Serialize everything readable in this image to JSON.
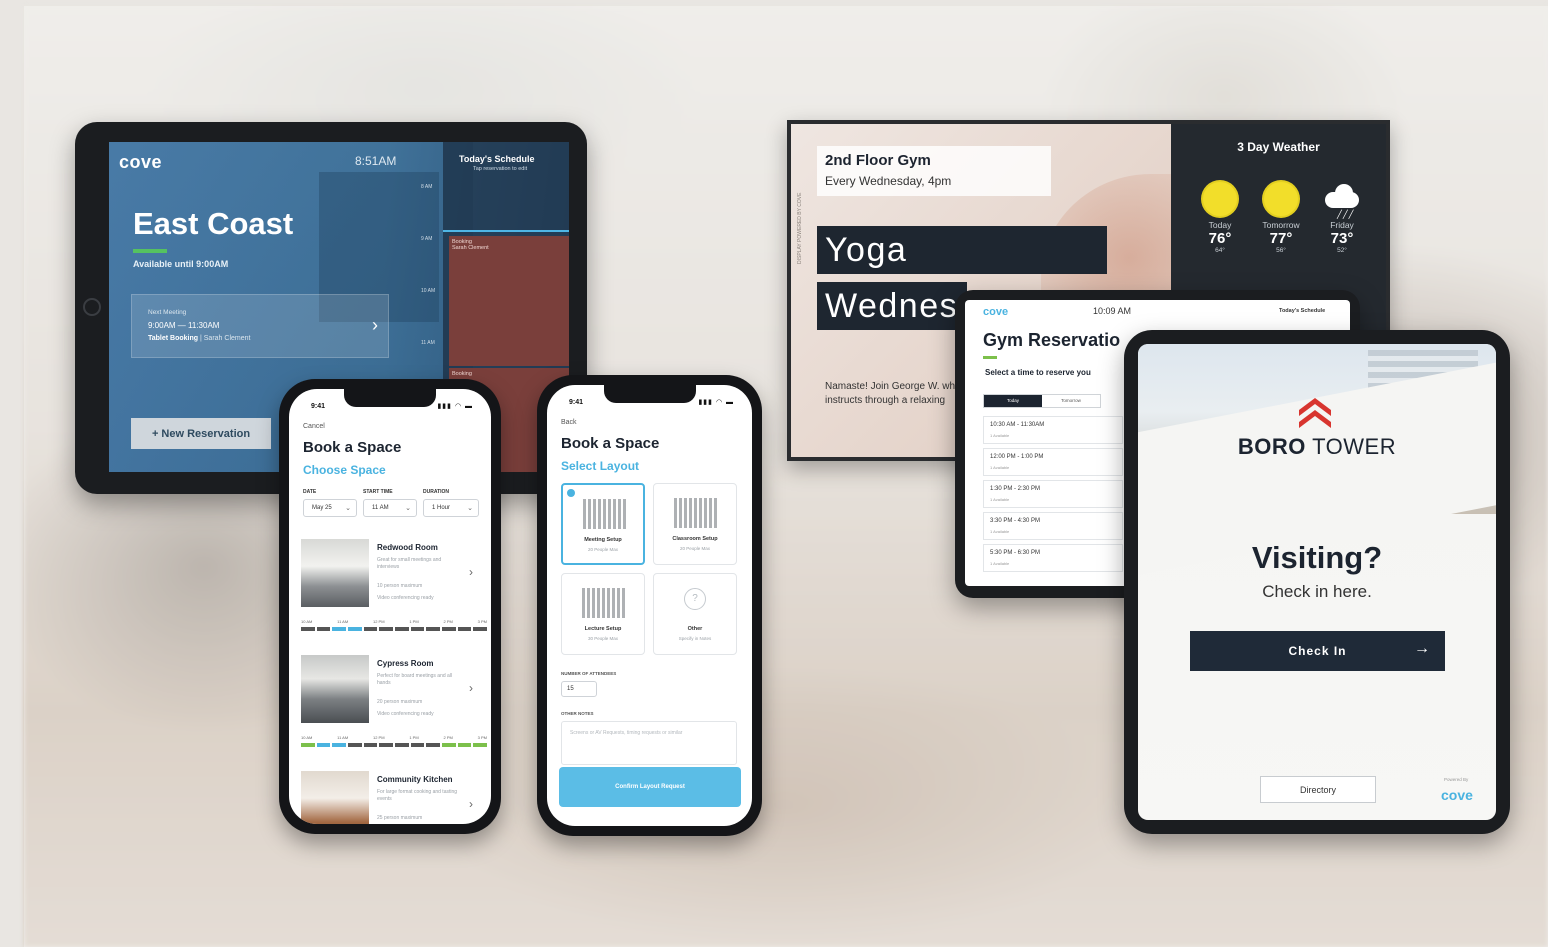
{
  "tablet_room": {
    "logo": "cove",
    "time": "8:51AM",
    "room_name": "East Coast",
    "availability": "Available until 9:00AM",
    "next_meeting_label": "Next Meeting",
    "next_meeting_time": "9:00AM — 11:30AM",
    "next_meeting_type": "Tablet Booking",
    "next_meeting_owner": "| Sarah Clement",
    "new_reservation_label": "+ New Reservation",
    "schedule_title": "Today's Schedule",
    "schedule_hint": "Tap reservation to edit",
    "schedule_ticks": [
      "8 AM",
      "9 AM",
      "10 AM",
      "11 AM"
    ],
    "bookings": [
      {
        "title": "Booking",
        "owner": "Sarah Clement"
      },
      {
        "title": "Booking",
        "owner": ""
      }
    ]
  },
  "phone_space": {
    "status_time": "9:41",
    "status_icons": "▮▮▮ ◠ ▬",
    "cancel_label": "Cancel",
    "title": "Book a Space",
    "subtitle": "Choose Space",
    "fields": [
      {
        "label": "DATE",
        "value": "May 25"
      },
      {
        "label": "START TIME",
        "value": "11 AM"
      },
      {
        "label": "DURATION",
        "value": "1 Hour"
      }
    ],
    "rooms": [
      {
        "name": "Redwood Room",
        "desc": "Great for small meetings and interviews",
        "capacity": "10 person maximum",
        "av": "Video conferencing ready"
      },
      {
        "name": "Cypress Room",
        "desc": "Perfect for board meetings and all hands",
        "capacity": "20 person maximum",
        "av": "Video conferencing ready"
      },
      {
        "name": "Community Kitchen",
        "desc": "For large format cooking and tasting events",
        "capacity": "25 person maximum",
        "av": ""
      }
    ],
    "slot_labels": [
      "10 AM",
      "11 AM",
      "12 PM",
      "1 PM",
      "2 PM",
      "3 PM"
    ]
  },
  "phone_layout": {
    "status_time": "9:41",
    "status_icons": "▮▮▮ ◠ ▬",
    "back_label": "Back",
    "title": "Book a Space",
    "subtitle": "Select Layout",
    "layouts": [
      {
        "name": "Meeting Setup",
        "cap": "20 People Max"
      },
      {
        "name": "Classroom Setup",
        "cap": "20 People Max"
      },
      {
        "name": "Lecture Setup",
        "cap": "30 People Max"
      },
      {
        "name": "Other",
        "cap": "Specify in Notes"
      }
    ],
    "attendees_label": "NUMBER OF ATTENDEES",
    "attendees_value": "15",
    "notes_label": "OTHER NOTES",
    "notes_placeholder": "Screens or AV Requests, timing requests or similar",
    "confirm_label": "Confirm Layout Request"
  },
  "tv_display": {
    "event_title": "2nd Floor Gym",
    "event_recurrence": "Every Wednesday, 4pm",
    "headline_1": "Yoga",
    "headline_2": "Wednes",
    "vertical_credit": "DISPLAY POWERED BY COVE",
    "description": "Namaste! Join George W. who instructs through a relaxing",
    "weather_title": "3 Day Weather",
    "forecast": [
      {
        "day": "Today",
        "hi": "76°",
        "lo": "64°",
        "icon": "sun-icon"
      },
      {
        "day": "Tomorrow",
        "hi": "77°",
        "lo": "56°",
        "icon": "sun-icon"
      },
      {
        "day": "Friday",
        "hi": "73°",
        "lo": "52°",
        "icon": "rain-cloud-icon"
      }
    ]
  },
  "tablet_gym": {
    "logo": "cove",
    "time": "10:09 AM",
    "schedule_label": "Today's Schedule",
    "title": "Gym Reservatio",
    "subtitle": "Select a time to reserve you",
    "tabs": [
      "Today",
      "Tomorrow"
    ],
    "slots": [
      {
        "time": "10:30 AM - 11:30AM",
        "avail": "1 Available"
      },
      {
        "time": "12:00 PM - 1:00 PM",
        "avail": "1 Available"
      },
      {
        "time": "1:30 PM - 2:30 PM",
        "avail": "1 Available"
      },
      {
        "time": "3:30 PM - 4:30 PM",
        "avail": "1 Available"
      },
      {
        "time": "5:30 PM - 6:30 PM",
        "avail": "1 Available"
      }
    ]
  },
  "tablet_visitor": {
    "brand_bold": "BORO",
    "brand_light": " TOWER",
    "heading": "Visiting?",
    "subheading": "Check in here.",
    "checkin_label": "Check In",
    "directory_label": "Directory",
    "powered_by": "Powered By",
    "powered_logo": "cove"
  },
  "colors": {
    "accent_blue": "#4ab3e0",
    "accent_green": "#7cc04b",
    "navy": "#1f2a38",
    "booking_red": "#7a3f3b",
    "sun_yellow": "#f2de2a",
    "brand_red": "#d8352f"
  }
}
